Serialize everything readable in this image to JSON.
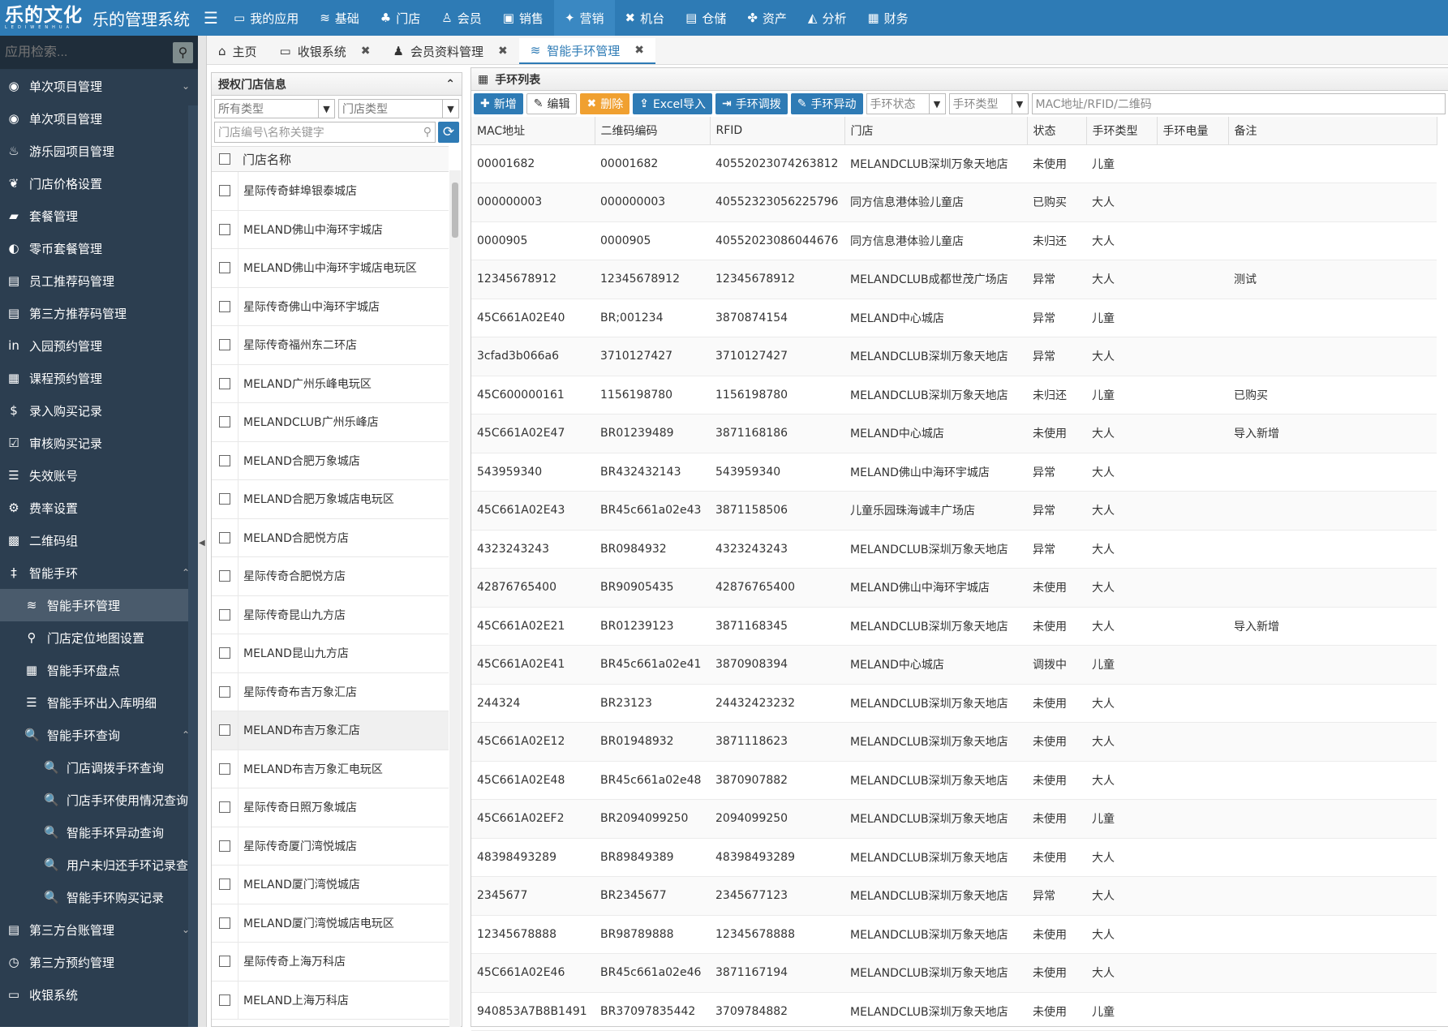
{
  "logo": {
    "brand": "乐的文化",
    "brand_sub": "LEDIWENHUA",
    "system": "乐的管理系统"
  },
  "topnav": [
    {
      "label": "我的应用",
      "icon": "monitor-icon",
      "glyph": "▭"
    },
    {
      "label": "基础",
      "icon": "database-icon",
      "glyph": "≋"
    },
    {
      "label": "门店",
      "icon": "sitemap-icon",
      "glyph": "♣"
    },
    {
      "label": "会员",
      "icon": "user-icon",
      "glyph": "♙"
    },
    {
      "label": "销售",
      "icon": "briefcase-icon",
      "glyph": "▣"
    },
    {
      "label": "营销",
      "icon": "bullhorn-icon",
      "glyph": "✦"
    },
    {
      "label": "机台",
      "icon": "gamepad-icon",
      "glyph": "✖"
    },
    {
      "label": "仓储",
      "icon": "storage-icon",
      "glyph": "▤"
    },
    {
      "label": "资产",
      "icon": "cubes-icon",
      "glyph": "✤"
    },
    {
      "label": "分析",
      "icon": "chart-icon",
      "glyph": "◭"
    },
    {
      "label": "财务",
      "icon": "calculator-icon",
      "glyph": "▦"
    }
  ],
  "active_topnav": 5,
  "sidebar": {
    "search_placeholder": "应用检索...",
    "items": [
      {
        "label": "单次项目管理",
        "icon": "gamepad-icon",
        "glyph": "◉",
        "arrow": "⌄",
        "level": 1
      },
      {
        "label": "单次项目管理",
        "icon": "gamepad-icon",
        "glyph": "◉",
        "level": 1
      },
      {
        "label": "游乐园项目管理",
        "icon": "amusement-icon",
        "glyph": "♨",
        "level": 1
      },
      {
        "label": "门店价格设置",
        "icon": "leaf-icon",
        "glyph": "❦",
        "level": 1
      },
      {
        "label": "套餐管理",
        "icon": "shopping-bag-icon",
        "glyph": "▰",
        "level": 1
      },
      {
        "label": "零币套餐管理",
        "icon": "coin-icon",
        "glyph": "◐",
        "level": 1
      },
      {
        "label": "员工推荐码管理",
        "icon": "list-icon",
        "glyph": "▤",
        "level": 1
      },
      {
        "label": "第三方推荐码管理",
        "icon": "list-icon",
        "glyph": "▤",
        "level": 1
      },
      {
        "label": "入园预约管理",
        "icon": "linkedin-icon",
        "glyph": "in",
        "level": 1
      },
      {
        "label": "课程预约管理",
        "icon": "calendar-icon",
        "glyph": "▦",
        "level": 1
      },
      {
        "label": "录入购买记录",
        "icon": "dollar-icon",
        "glyph": "$",
        "level": 1
      },
      {
        "label": "审核购买记录",
        "icon": "check-icon",
        "glyph": "☑",
        "level": 1
      },
      {
        "label": "失效账号",
        "icon": "list-icon",
        "glyph": "☰",
        "level": 1
      },
      {
        "label": "费率设置",
        "icon": "gear-icon",
        "glyph": "⚙",
        "level": 1
      },
      {
        "label": "二维码组",
        "icon": "qrcode-icon",
        "glyph": "▩",
        "level": 1
      },
      {
        "label": "智能手环",
        "icon": "band-icon",
        "glyph": "‡",
        "arrow": "⌃",
        "level": 1,
        "open": true
      },
      {
        "label": "智能手环管理",
        "icon": "database-icon",
        "glyph": "≋",
        "level": 2,
        "selected": true
      },
      {
        "label": "门店定位地图设置",
        "icon": "map-marker-icon",
        "glyph": "⚲",
        "level": 2
      },
      {
        "label": "智能手环盘点",
        "icon": "calculator-icon",
        "glyph": "▦",
        "level": 2
      },
      {
        "label": "智能手环出入库明细",
        "icon": "list-icon",
        "glyph": "☰",
        "level": 2
      },
      {
        "label": "智能手环查询",
        "icon": "search-icon",
        "glyph": "🔍",
        "arrow": "⌃",
        "level": 2,
        "open": true
      },
      {
        "label": "门店调拨手环查询",
        "icon": "search-icon",
        "glyph": "🔍",
        "level": 3
      },
      {
        "label": "门店手环使用情况查询",
        "icon": "search-icon",
        "glyph": "🔍",
        "level": 3
      },
      {
        "label": "智能手环异动查询",
        "icon": "search-icon",
        "glyph": "🔍",
        "level": 3
      },
      {
        "label": "用户未归还手环记录查",
        "icon": "search-icon",
        "glyph": "🔍",
        "level": 3
      },
      {
        "label": "智能手环购买记录",
        "icon": "search-icon",
        "glyph": "🔍",
        "level": 3
      },
      {
        "label": "第三方台账管理",
        "icon": "list-icon",
        "glyph": "▤",
        "arrow": "⌄",
        "level": 1
      },
      {
        "label": "第三方预约管理",
        "icon": "clock-icon",
        "glyph": "◷",
        "level": 1
      },
      {
        "label": "收银系统",
        "icon": "monitor-icon",
        "glyph": "▭",
        "level": 1
      }
    ]
  },
  "tabs": [
    {
      "label": "主页",
      "icon": "home-icon",
      "glyph": "⌂",
      "closable": false
    },
    {
      "label": "收银系统",
      "icon": "monitor-icon",
      "glyph": "▭",
      "closable": true
    },
    {
      "label": "会员资料管理",
      "icon": "users-icon",
      "glyph": "♟",
      "closable": true
    },
    {
      "label": "智能手环管理",
      "icon": "database-icon",
      "glyph": "≋",
      "closable": true,
      "active": true
    }
  ],
  "close_glyph": "✖",
  "store_panel": {
    "title": "授权门店信息",
    "collapse_glyph": "⌃",
    "type_select": "所有类型",
    "store_type_placeholder": "门店类型",
    "search_placeholder": "门店编号\\名称关键字",
    "column": "门店名称",
    "stores": [
      "星际传奇蚌埠银泰城店",
      "MELAND佛山中海环宇城店",
      "MELAND佛山中海环宇城店电玩区",
      "星际传奇佛山中海环宇城店",
      "星际传奇福州东二环店",
      "MELAND广州乐峰电玩区",
      "MELANDCLUB广州乐峰店",
      "MELAND合肥万象城店",
      "MELAND合肥万象城店电玩区",
      "MELAND合肥悦方店",
      "星际传奇合肥悦方店",
      "星际传奇昆山九方店",
      "MELAND昆山九方店",
      "星际传奇布吉万象汇店",
      "MELAND布吉万象汇店",
      "MELAND布吉万象汇电玩区",
      "星际传奇日照万象城店",
      "星际传奇厦门湾悦城店",
      "MELAND厦门湾悦城店",
      "MELAND厦门湾悦城店电玩区",
      "星际传奇上海万科店",
      "MELAND上海万科店"
    ],
    "highlight_index": 14
  },
  "band_panel": {
    "title": "手环列表",
    "buttons": {
      "add": "新增",
      "edit": "编辑",
      "delete": "删除",
      "import": "Excel导入",
      "transfer": "手环调拨",
      "exception": "手环异动"
    },
    "status_placeholder": "手环状态",
    "type_placeholder": "手环类型",
    "search_placeholder": "MAC地址/RFID/二维码",
    "columns": [
      "MAC地址",
      "二维码编码",
      "RFID",
      "门店",
      "状态",
      "手环类型",
      "手环电量",
      "备注"
    ],
    "rows": [
      [
        "00001682",
        "00001682",
        "40552023074263812",
        "MELANDCLUB深圳万象天地店",
        "未使用",
        "儿童",
        "",
        ""
      ],
      [
        "000000003",
        "000000003",
        "40552323056225796",
        "同方信息港体验儿童店",
        "已购买",
        "大人",
        "",
        ""
      ],
      [
        "0000905",
        "0000905",
        "40552023086044676",
        "同方信息港体验儿童店",
        "未归还",
        "大人",
        "",
        ""
      ],
      [
        "12345678912",
        "12345678912",
        "12345678912",
        "MELANDCLUB成都世茂广场店",
        "异常",
        "大人",
        "",
        "测试"
      ],
      [
        "45C661A02E40",
        "BR;001234",
        "3870874154",
        "MELAND中心城店",
        "异常",
        "儿童",
        "",
        ""
      ],
      [
        "3cfad3b066a6",
        "3710127427",
        "3710127427",
        "MELANDCLUB深圳万象天地店",
        "异常",
        "大人",
        "",
        ""
      ],
      [
        "45C600000161",
        "1156198780",
        "1156198780",
        "MELANDCLUB深圳万象天地店",
        "未归还",
        "儿童",
        "",
        "已购买"
      ],
      [
        "45C661A02E47",
        "BR01239489",
        "3871168186",
        "MELAND中心城店",
        "未使用",
        "大人",
        "",
        "导入新增"
      ],
      [
        "543959340",
        "BR432432143",
        "543959340",
        "MELAND佛山中海环宇城店",
        "异常",
        "大人",
        "",
        ""
      ],
      [
        "45C661A02E43",
        "BR45c661a02e43",
        "3871158506",
        "儿童乐园珠海诚丰广场店",
        "异常",
        "大人",
        "",
        ""
      ],
      [
        "4323243243",
        "BR0984932",
        "4323243243",
        "MELANDCLUB深圳万象天地店",
        "异常",
        "大人",
        "",
        ""
      ],
      [
        "42876765400",
        "BR90905435",
        "42876765400",
        "MELAND佛山中海环宇城店",
        "未使用",
        "大人",
        "",
        ""
      ],
      [
        "45C661A02E21",
        "BR01239123",
        "3871168345",
        "MELANDCLUB深圳万象天地店",
        "未使用",
        "大人",
        "",
        "导入新增"
      ],
      [
        "45C661A02E41",
        "BR45c661a02e41",
        "3870908394",
        "MELAND中心城店",
        "调拨中",
        "儿童",
        "",
        ""
      ],
      [
        "244324",
        "BR23123",
        "24432423232",
        "MELANDCLUB深圳万象天地店",
        "未使用",
        "大人",
        "",
        ""
      ],
      [
        "45C661A02E12",
        "BR01948932",
        "3871118623",
        "MELANDCLUB深圳万象天地店",
        "未使用",
        "大人",
        "",
        ""
      ],
      [
        "45C661A02E48",
        "BR45c661a02e48",
        "3870907882",
        "MELANDCLUB深圳万象天地店",
        "未使用",
        "大人",
        "",
        ""
      ],
      [
        "45C661A02EF2",
        "BR2094099250",
        "2094099250",
        "MELANDCLUB深圳万象天地店",
        "未使用",
        "儿童",
        "",
        ""
      ],
      [
        "48398493289",
        "BR89849389",
        "48398493289",
        "MELANDCLUB深圳万象天地店",
        "未使用",
        "大人",
        "",
        ""
      ],
      [
        "2345677",
        "BR2345677",
        "2345677123",
        "MELANDCLUB深圳万象天地店",
        "异常",
        "大人",
        "",
        ""
      ],
      [
        "12345678888",
        "BR98789888",
        "12345678888",
        "MELANDCLUB深圳万象天地店",
        "未使用",
        "大人",
        "",
        ""
      ],
      [
        "45C661A02E46",
        "BR45c661a02e46",
        "3871167194",
        "MELANDCLUB深圳万象天地店",
        "未使用",
        "大人",
        "",
        ""
      ],
      [
        "940853A7B8B1491",
        "BR37097835442",
        "3709784882",
        "MELANDCLUB深圳万象天地店",
        "未使用",
        "儿童",
        "",
        ""
      ]
    ]
  },
  "colors": {
    "topbar": "#2e7bb5",
    "sidebar": "#2c3e50",
    "orange": "#f0a030"
  }
}
